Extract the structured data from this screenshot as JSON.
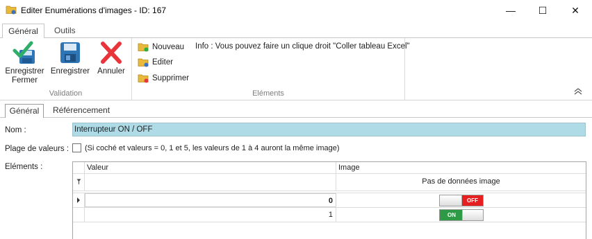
{
  "window": {
    "title": "Editer Enumérations d'images - ID: 167",
    "minimize_glyph": "—",
    "maximize_glyph": "☐",
    "close_glyph": "✕"
  },
  "ribbon": {
    "tabs": [
      {
        "label": "Général",
        "active": true
      },
      {
        "label": "Outils",
        "active": false
      }
    ],
    "validation": {
      "group_label": "Validation",
      "save_close_label_1": "Enregistrer",
      "save_close_label_2": "Fermer",
      "save_label": "Enregistrer",
      "cancel_label": "Annuler"
    },
    "elements": {
      "group_label": "Eléments",
      "new_label": "Nouveau",
      "edit_label": "Editer",
      "delete_label": "Supprimer",
      "info": "Info : Vous pouvez faire un clique droit \"Coller tableau Excel\""
    }
  },
  "inner_tabs": [
    {
      "label": "Général",
      "active": true
    },
    {
      "label": "Référencement",
      "active": false
    }
  ],
  "form": {
    "nom_label": "Nom :",
    "nom_value": "Interrupteur ON / OFF",
    "plage_label": "Plage de valeurs :",
    "plage_checked": false,
    "plage_hint": "(Si coché et valeurs = 0, 1 et 5, les valeurs de 1 à 4 auront la même image)",
    "elements_label": "Eléments :"
  },
  "grid": {
    "columns": [
      "Valeur",
      "Image"
    ],
    "filter_image_text": "Pas de données image",
    "rows": [
      {
        "value": "0",
        "image": "switch-off",
        "toggle_text": "OFF",
        "selected": true
      },
      {
        "value": "1",
        "image": "switch-on",
        "toggle_text": "ON",
        "selected": false
      }
    ]
  },
  "colors": {
    "nom_background": "#aedbe6",
    "accent_blue": "#2e75b6",
    "on_green": "#2f9a45",
    "off_red": "#e62020"
  }
}
